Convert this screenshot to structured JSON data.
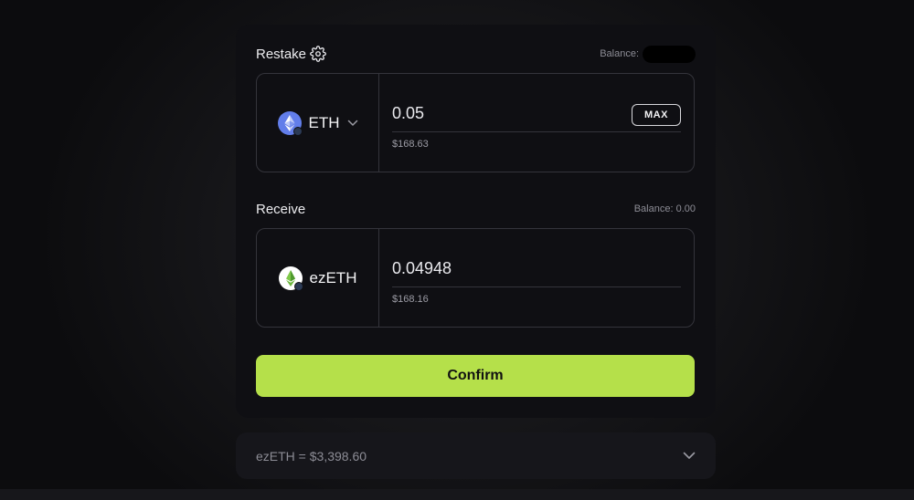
{
  "restake": {
    "title": "Restake",
    "balance_label": "Balance:",
    "token": "ETH",
    "amount": "0.05",
    "usd_value": "$168.63",
    "max_label": "MAX"
  },
  "receive": {
    "title": "Receive",
    "balance_label": "Balance: 0.00",
    "token": "ezETH",
    "amount": "0.04948",
    "usd_value": "$168.16"
  },
  "confirm_label": "Confirm",
  "rate": {
    "text": "ezETH = $3,398.60"
  },
  "colors": {
    "accent": "#b5e04a",
    "card": "#0f0f13",
    "border": "#34343b"
  },
  "icons": [
    "gear-icon",
    "eth-token-icon",
    "chevron-down-icon",
    "ezeth-token-icon"
  ]
}
